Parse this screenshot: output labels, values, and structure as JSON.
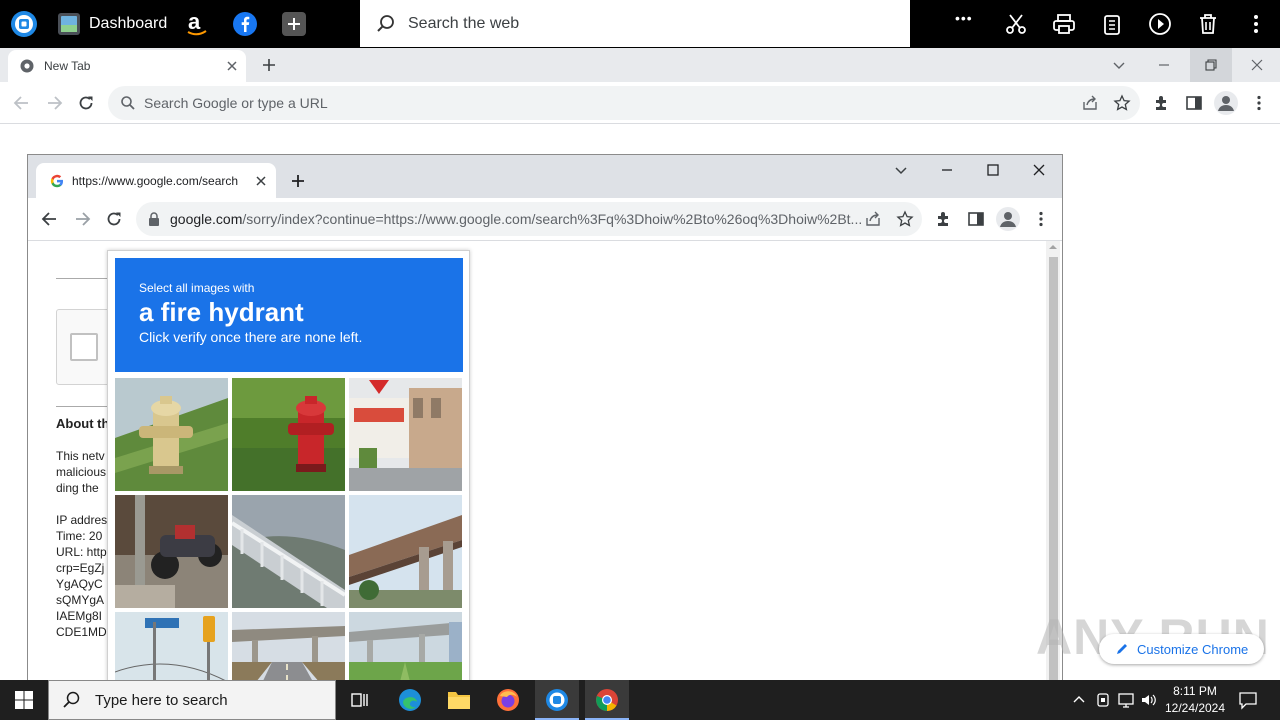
{
  "launcher": {
    "dashboard_label": "Dashboard",
    "search_placeholder": "Search the web",
    "more_label": "•••"
  },
  "outer_browser": {
    "tab_title": "New Tab",
    "omnibox_placeholder": "Search Google or type a URL"
  },
  "inner_browser": {
    "tab_title": "https://www.google.com/search",
    "url_host": "google.com",
    "url_path": "/sorry/index?continue=https://www.google.com/search%3Fq%3Dhoiw%2Bto%26oq%3Dhoiw%2Bt..."
  },
  "page": {
    "heading_fragment": "About th",
    "text_lines": [
      "This netv",
      "malicious",
      "ding the"
    ],
    "info_lines": [
      "IP addres",
      "Time: 20",
      "URL: http",
      "crp=EgZj",
      "YgAQyC",
      "sQMYgA",
      "IAEMg8I",
      "CDE1MD"
    ]
  },
  "captcha": {
    "line1": "Select all images with",
    "line2": "a fire hydrant",
    "line3": "Click verify once there are none left.",
    "header_color": "#1a73e8",
    "tiles": [
      "yellow fire hydrant on grass",
      "red fire hydrant on grass",
      "street with shop buildings",
      "parked motorcycles",
      "highway overpass railings",
      "elevated bridge over road",
      "street signs and traffic light",
      "highway interchange",
      "overpass above green field"
    ]
  },
  "customize_chrome": "Customize Chrome",
  "watermark": "ANY RUN",
  "taskbar": {
    "search_placeholder": "Type here to search",
    "time": "8:11 PM",
    "date": "12/24/2024"
  }
}
